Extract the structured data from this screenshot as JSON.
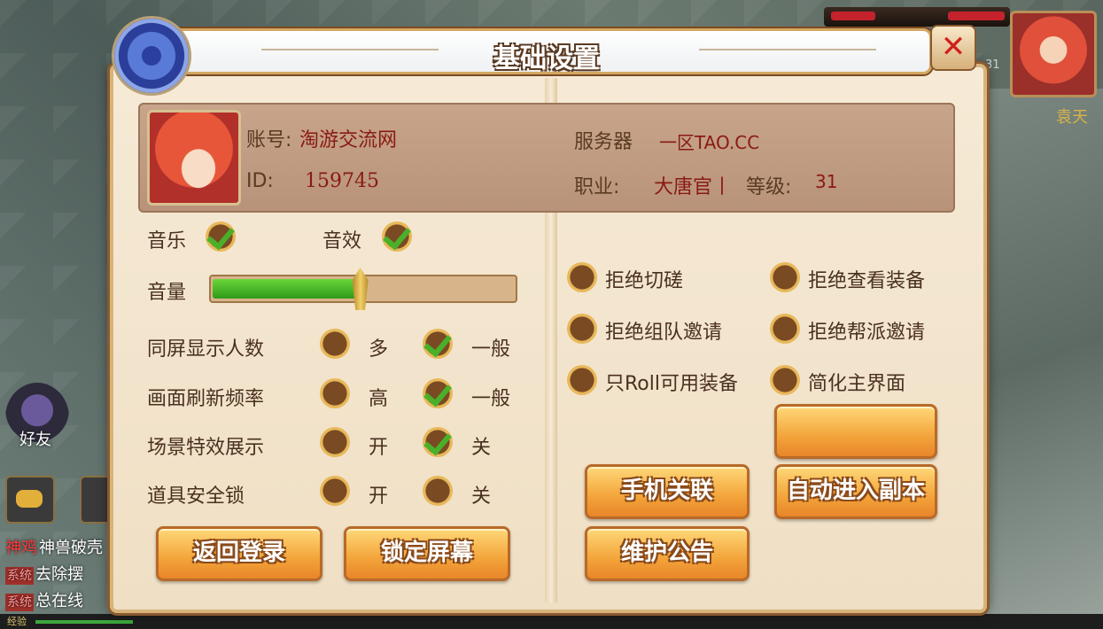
{
  "dialog": {
    "title": "基础设置",
    "close_label": "✕"
  },
  "account": {
    "account_label": "账号:",
    "account_value": "淘游交流网",
    "id_label": "ID:",
    "id_value": "159745",
    "server_label": "服务器",
    "server_value": "一区TAO.CC",
    "job_label": "职业:",
    "job_value": "大唐官丨",
    "level_label": "等级:",
    "level_value": "31"
  },
  "audio": {
    "music_label": "音乐",
    "music_on": true,
    "sfx_label": "音效",
    "sfx_on": true,
    "volume_label": "音量",
    "volume_level": 0.49
  },
  "settings": [
    {
      "label": "同屏显示人数",
      "opt1": "多",
      "opt2": "一般",
      "selected": 2
    },
    {
      "label": "画面刷新频率",
      "opt1": "高",
      "opt2": "一般",
      "selected": 2
    },
    {
      "label": "场景特效展示",
      "opt1": "开",
      "opt2": "关",
      "selected": 2
    },
    {
      "label": "道具安全锁",
      "opt1": "开",
      "opt2": "关",
      "selected": 0
    }
  ],
  "toggles": [
    {
      "label": "拒绝切磋",
      "on": false
    },
    {
      "label": "拒绝查看装备",
      "on": false
    },
    {
      "label": "拒绝组队邀请",
      "on": false
    },
    {
      "label": "拒绝帮派邀请",
      "on": false
    },
    {
      "label": "只Roll可用装备",
      "on": false
    },
    {
      "label": "简化主界面",
      "on": false
    }
  ],
  "buttons": {
    "back_login": "返回登录",
    "lock_screen": "锁定屏幕",
    "phone_link": "手机关联",
    "auto_dungeon": "自动进入副本",
    "maintenance": "维护公告",
    "blank": ""
  },
  "background": {
    "friend_label": "好友",
    "right_name": "袁天",
    "right_level": "31",
    "chat": [
      {
        "tag": "神鸡",
        "text": "神兽破壳"
      },
      {
        "tag": "系统",
        "text": "去除摆"
      },
      {
        "tag": "系统",
        "text": "总在线"
      }
    ],
    "exp_label": "经验"
  },
  "colors": {
    "accent": "#f3a43a",
    "check": "#4ab02a",
    "value_red": "#8a1a12",
    "panel_brown": "#c8a58a"
  }
}
